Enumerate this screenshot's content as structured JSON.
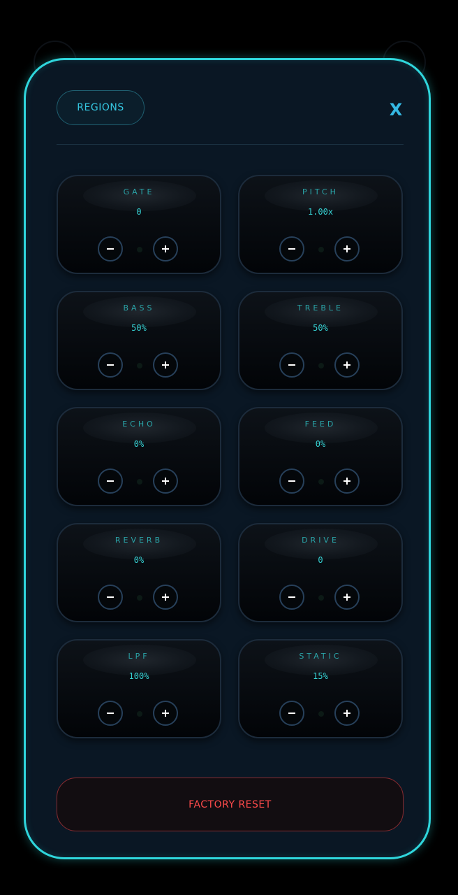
{
  "header": {
    "regions_label": "REGIONS",
    "close_label": "X"
  },
  "controls": [
    {
      "label": "GATE",
      "value": "0"
    },
    {
      "label": "PITCH",
      "value": "1.00x"
    },
    {
      "label": "BASS",
      "value": "50%"
    },
    {
      "label": "TREBLE",
      "value": "50%"
    },
    {
      "label": "ECHO",
      "value": "0%"
    },
    {
      "label": "FEED",
      "value": "0%"
    },
    {
      "label": "REVERB",
      "value": "0%"
    },
    {
      "label": "DRIVE",
      "value": "0"
    },
    {
      "label": "LPF",
      "value": "100%"
    },
    {
      "label": "STATIC",
      "value": "15%"
    }
  ],
  "footer": {
    "factory_reset_label": "FACTORY RESET"
  },
  "colors": {
    "accent_cyan": "#2fd6dc",
    "label_teal": "#2aa4a8",
    "reset_red": "#ff4b4b",
    "panel_bg": "#0a1724"
  },
  "icons": {
    "minus": "minus-icon",
    "plus": "plus-icon",
    "close": "close-icon"
  }
}
